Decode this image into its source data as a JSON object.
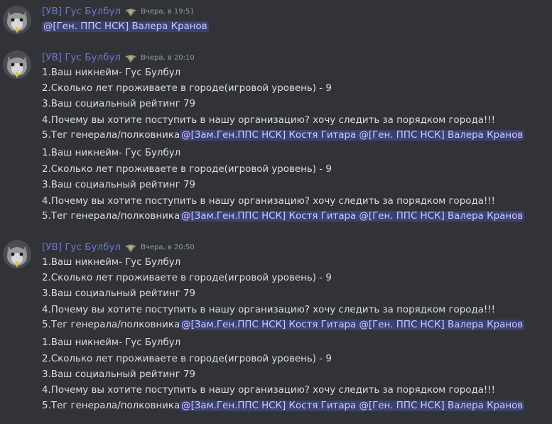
{
  "messages": [
    {
      "username": "[УВ] Гус Булбул",
      "timestamp": "Вчера, в 19:51",
      "mention_only": "@[Ген. ППС НСК]  Валера Кранов"
    },
    {
      "username": "[УВ] Гус Булбул",
      "timestamp": "Вчера, в 20:10",
      "blocks": [
        {
          "l1": "1.Ваш никнейм- Гус Булбул",
          "l2": "2.Сколько лет проживаете в городе(игровой уровень) - 9",
          "l3": "3.Ваш социальный рейтинг 79",
          "l4": "4.Почему вы хотите поступить в нашу организацию? хочу следить за порядком города!!!",
          "l5_prefix": "5.Тег генерала/полковника",
          "l5_mention": "@[Зам.Ген.ППС НСК] Костя Гитара @[Ген. ППС НСК]  Валера Кранов"
        },
        {
          "l1": "1.Ваш никнейм- Гус Булбул",
          "l2": "2.Сколько лет проживаете в городе(игровой уровень) - 9",
          "l3": "3.Ваш социальный рейтинг 79",
          "l4": "4.Почему вы хотите поступить в нашу организацию? хочу следить за порядком города!!!",
          "l5_prefix": "5.Тег генерала/полковника",
          "l5_mention": "@[Зам.Ген.ППС НСК] Костя Гитара @[Ген. ППС НСК]  Валера Кранов"
        }
      ]
    },
    {
      "username": "[УВ] Гус Булбул",
      "timestamp": "Вчера, в 20:50",
      "blocks": [
        {
          "l1": "1.Ваш никнейм- Гус Булбул",
          "l2": "2.Сколько лет проживаете в городе(игровой уровень) - 9",
          "l3": "3.Ваш социальный рейтинг 79",
          "l4": "4.Почему вы хотите поступить в нашу организацию? хочу следить за порядком города!!!",
          "l5_prefix": "5.Тег генерала/полковника",
          "l5_mention": "@[Зам.Ген.ППС НСК] Костя Гитара @[Ген. ППС НСК]  Валера Кранов"
        },
        {
          "l1": "1.Ваш никнейм- Гус Булбул",
          "l2": "2.Сколько лет проживаете в городе(игровой уровень) - 9",
          "l3": "3.Ваш социальный рейтинг 79",
          "l4": "4.Почему вы хотите поступить в нашу организацию? хочу следить за порядком города!!!",
          "l5_prefix": "5.Тег генерала/полковника",
          "l5_mention": "@[Зам.Ген.ППС НСК] Костя Гитара @[Ген. ППС НСК]  Валера Кранов"
        }
      ]
    }
  ],
  "icons": {
    "avatar": "cat-avatar-icon",
    "badge": "police-badge-icon"
  },
  "colors": {
    "background": "#313338",
    "username": "#6b76d6",
    "text": "#dbdee1",
    "timestamp": "#949ba4",
    "mention_bg": "#4a4f8a",
    "mention_text": "#c9cdfb"
  }
}
